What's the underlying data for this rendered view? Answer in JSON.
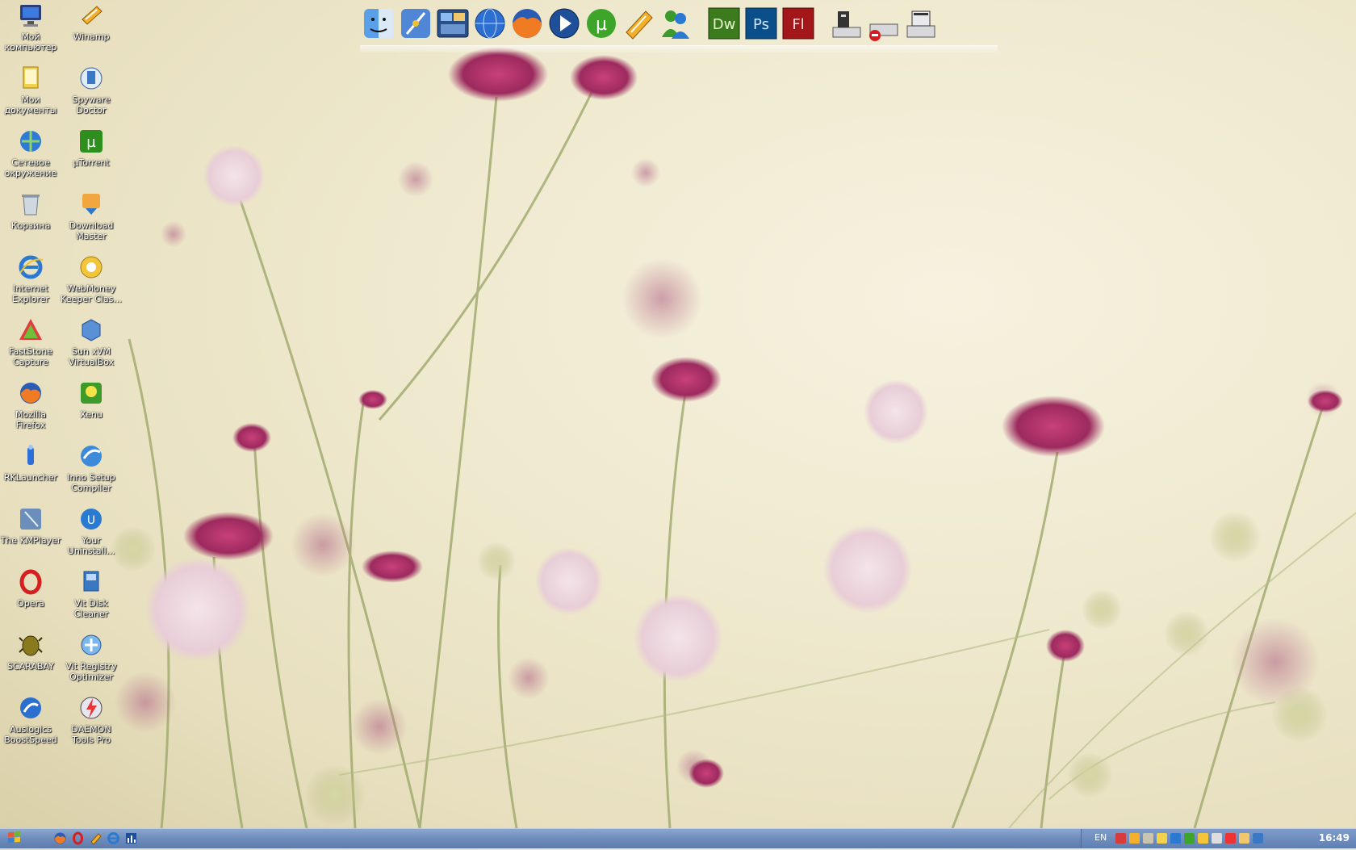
{
  "desktop": {
    "icons": [
      {
        "label": "Мой компьютер",
        "icon": "my-computer-icon"
      },
      {
        "label": "Winamp",
        "icon": "winamp-icon"
      },
      {
        "label": "Мои документы",
        "icon": "my-documents-icon"
      },
      {
        "label": "Spyware Doctor",
        "icon": "spyware-doctor-icon"
      },
      {
        "label": "Сетевое окружение",
        "icon": "network-icon"
      },
      {
        "label": "µTorrent",
        "icon": "utorrent-icon"
      },
      {
        "label": "Корзина",
        "icon": "recycle-bin-icon"
      },
      {
        "label": "Download Master",
        "icon": "download-master-icon"
      },
      {
        "label": "Internet Explorer",
        "icon": "internet-explorer-icon"
      },
      {
        "label": "WebMoney Keeper Clas...",
        "icon": "webmoney-icon"
      },
      {
        "label": "FastStone Capture",
        "icon": "faststone-capture-icon"
      },
      {
        "label": "Sun xVM VirtualBox",
        "icon": "virtualbox-icon"
      },
      {
        "label": "Mozilla Firefox",
        "icon": "firefox-icon"
      },
      {
        "label": "Xenu",
        "icon": "xenu-icon"
      },
      {
        "label": "RKLauncher",
        "icon": "rklauncher-icon"
      },
      {
        "label": "Inno Setup Compiler",
        "icon": "inno-setup-icon"
      },
      {
        "label": "The KMPlayer",
        "icon": "kmplayer-icon"
      },
      {
        "label": "Your Uninstall...",
        "icon": "your-uninstaller-icon"
      },
      {
        "label": "Opera",
        "icon": "opera-icon"
      },
      {
        "label": "Vit Disk Cleaner",
        "icon": "vit-disk-cleaner-icon"
      },
      {
        "label": "SCARABAY",
        "icon": "scarabay-icon"
      },
      {
        "label": "Vit Registry Optimizer",
        "icon": "vit-registry-icon"
      },
      {
        "label": "Auslogics BoostSpeed",
        "icon": "auslogics-icon"
      },
      {
        "label": "DAEMON Tools Pro",
        "icon": "daemon-tools-icon"
      }
    ]
  },
  "dock": {
    "items": [
      {
        "name": "finder-icon",
        "text": ""
      },
      {
        "name": "compass-icon",
        "text": ""
      },
      {
        "name": "dashboard-icon",
        "text": ""
      },
      {
        "name": "globe-icon",
        "text": ""
      },
      {
        "name": "firefox-icon",
        "text": ""
      },
      {
        "name": "media-player-icon",
        "text": ""
      },
      {
        "name": "utorrent-icon",
        "text": "µ"
      },
      {
        "name": "winamp-icon",
        "text": ""
      },
      {
        "name": "messenger-icon",
        "text": ""
      },
      {
        "name": "dreamweaver-icon",
        "text": "Dw"
      },
      {
        "name": "photoshop-icon",
        "text": "Ps"
      },
      {
        "name": "flash-icon",
        "text": "Fl"
      },
      {
        "name": "drive-icon",
        "text": ""
      },
      {
        "name": "drive-eject-icon",
        "text": ""
      },
      {
        "name": "drive-card-icon",
        "text": ""
      }
    ]
  },
  "taskbar": {
    "start_icon": "start-icon",
    "quick_launch": [
      "firefox-icon",
      "opera-icon",
      "winamp-icon",
      "internet-explorer-icon",
      "chart-icon"
    ],
    "tray": {
      "language": "EN",
      "clock": "16:49",
      "icons": [
        "faststone-icon",
        "winamp-icon",
        "shield-icon",
        "network-icon",
        "monitor-icon",
        "utorrent-icon",
        "webmoney-icon",
        "volume-icon",
        "daemon-icon",
        "folder-icon",
        "display-icon"
      ]
    }
  },
  "colors": {
    "taskbar": "#6d8cbb",
    "flower": "#9c2a5e",
    "photoshop": "#0b4f8a",
    "dreamweaver": "#3c7a1e",
    "flash": "#a3171b"
  }
}
